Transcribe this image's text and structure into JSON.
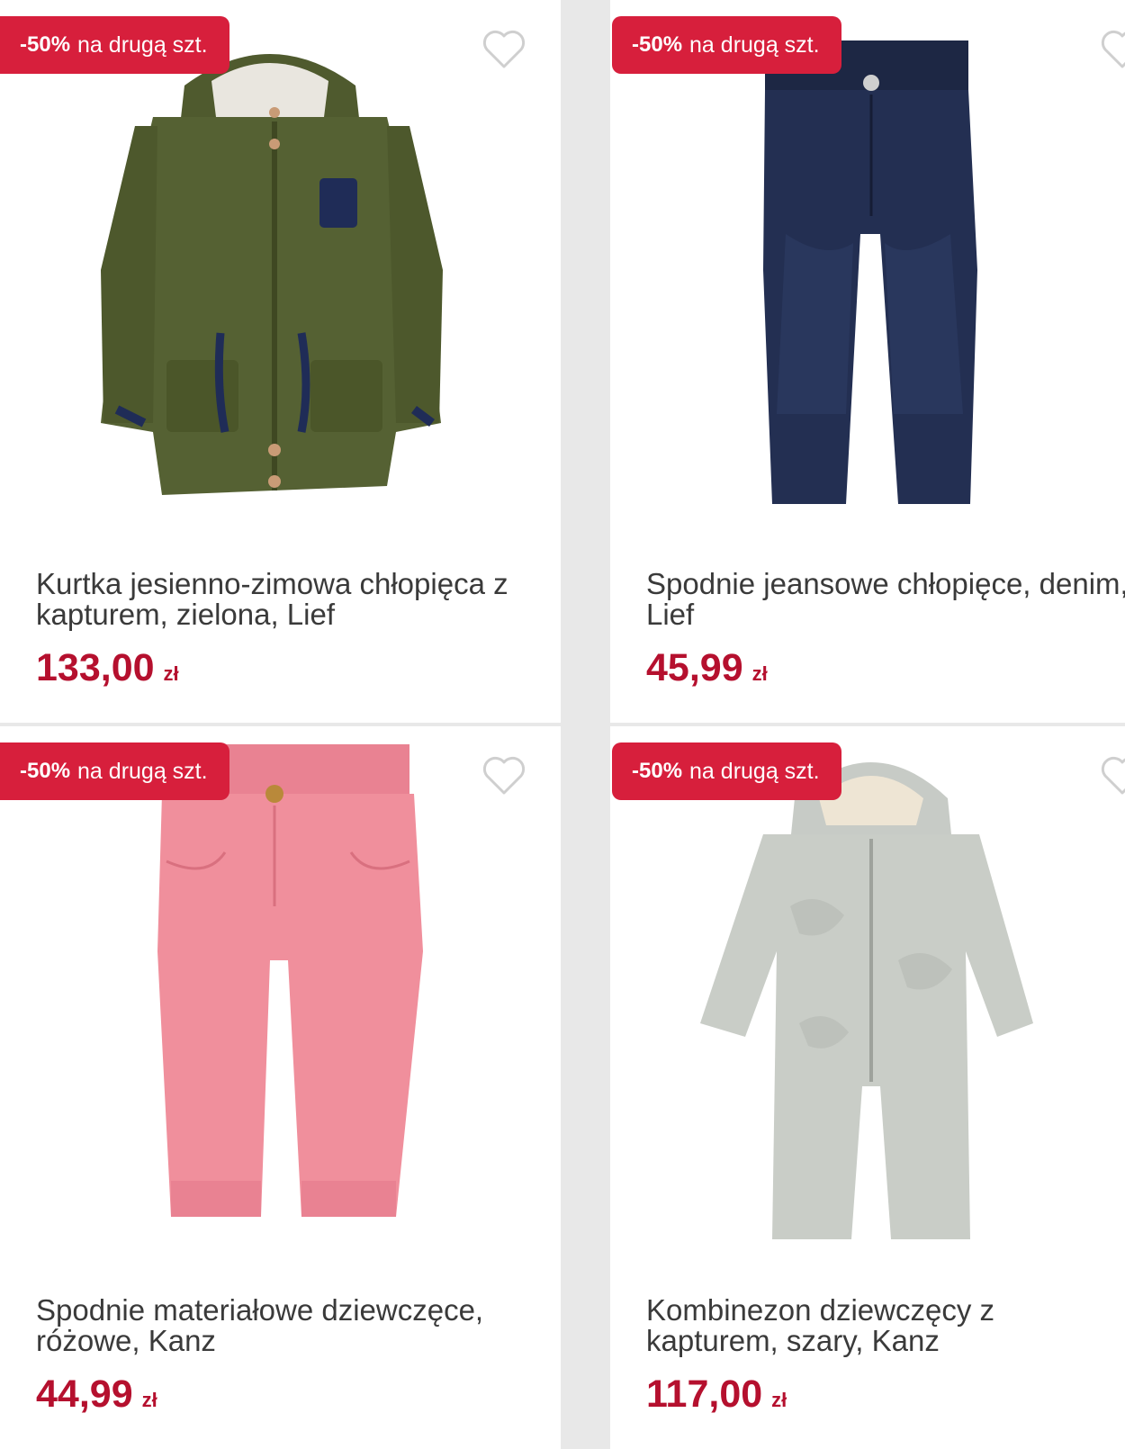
{
  "products": [
    {
      "badge_pct": "-50%",
      "badge_text": "na drugą szt.",
      "name": "Kurtka jesienno-zimowa chłopięca z kapturem, zielona, Lief",
      "price": "133,00",
      "currency": "zł",
      "icon": "heart-outline-icon"
    },
    {
      "badge_pct": "-50%",
      "badge_text": "na drugą szt.",
      "name": "Spodnie jeansowe chłopięce, denim, Lief",
      "price": "45,99",
      "currency": "zł",
      "icon": "heart-outline-icon"
    },
    {
      "badge_pct": "-50%",
      "badge_text": "na drugą szt.",
      "name": "Spodnie materiałowe dziewczęce, różowe, Kanz",
      "price": "44,99",
      "currency": "zł",
      "icon": "heart-outline-icon"
    },
    {
      "badge_pct": "-50%",
      "badge_text": "na drugą szt.",
      "name": "Kombinezon dziewczęcy z kapturem, szary, Kanz",
      "price": "117,00",
      "currency": "zł",
      "icon": "heart-outline-icon"
    }
  ],
  "colors": {
    "badge": "#d71f3c",
    "price": "#b5102e",
    "divider": "#e8e8e8"
  }
}
